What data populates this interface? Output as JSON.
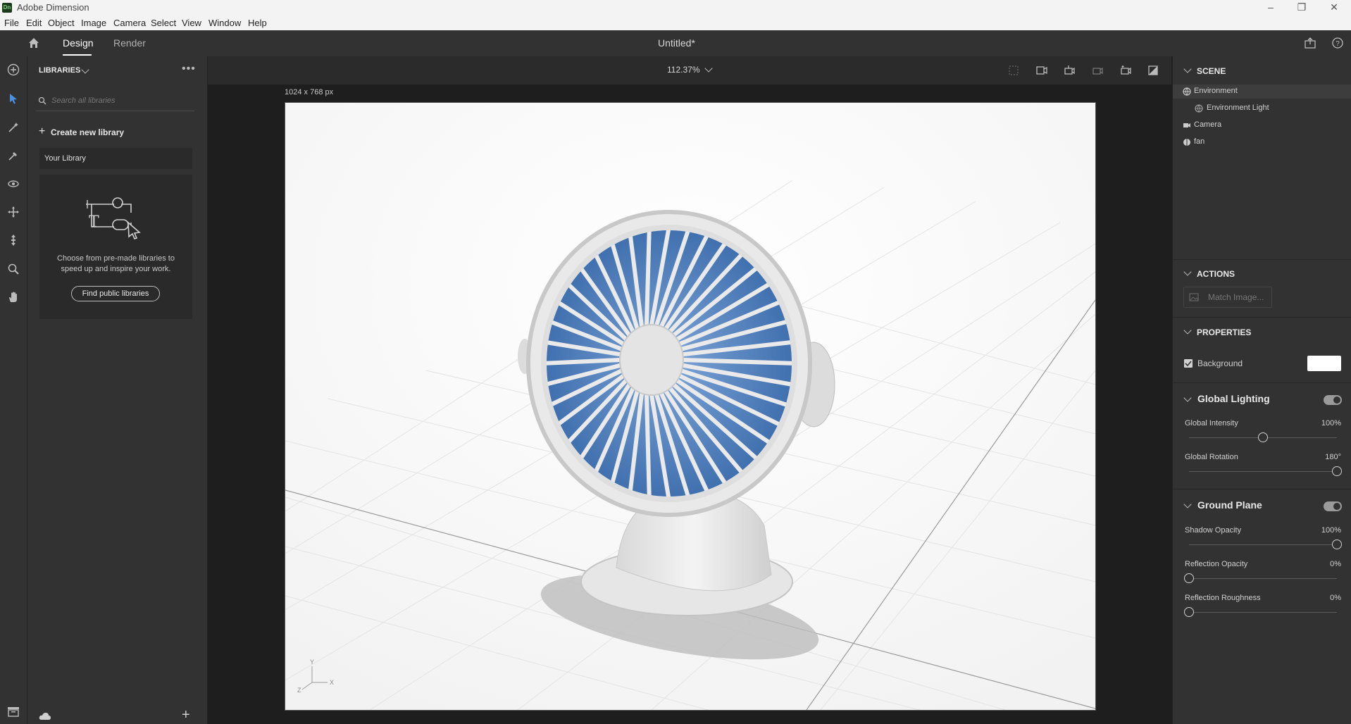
{
  "window": {
    "app_title": "Adobe Dimension",
    "logo_text": "Dn"
  },
  "menu": [
    "File",
    "Edit",
    "Object",
    "Image",
    "Camera",
    "Select",
    "View",
    "Window",
    "Help"
  ],
  "header": {
    "tabs": [
      "Design",
      "Render"
    ],
    "active_tab": "Design",
    "document_title": "Untitled*"
  },
  "libraries": {
    "title": "LIBRARIES",
    "search_placeholder": "Search all libraries",
    "create_label": "Create new library",
    "your_library": "Your Library",
    "promo_text": "Choose from pre-made libraries to speed up and inspire your work.",
    "find_button": "Find public libraries"
  },
  "canvas": {
    "zoom": "112.37%",
    "size_label": "1024 x 768 px",
    "axis_y": "Y",
    "axis_x": "X",
    "axis_z": "Z"
  },
  "scene": {
    "title": "SCENE",
    "items": [
      {
        "label": "Environment",
        "icon": "environment-icon"
      },
      {
        "label": "Environment Light",
        "icon": "globe-icon"
      },
      {
        "label": "Camera",
        "icon": "camera-icon"
      },
      {
        "label": "fan",
        "icon": "model-icon"
      }
    ]
  },
  "actions": {
    "title": "ACTIONS",
    "match_image": "Match Image..."
  },
  "properties": {
    "title": "PROPERTIES",
    "background_label": "Background",
    "background_color": "#ffffff",
    "global_lighting": "Global Lighting",
    "global_intensity_label": "Global Intensity",
    "global_intensity_value": "100%",
    "global_intensity_fraction": 0.5,
    "global_rotation_label": "Global Rotation",
    "global_rotation_value": "180°",
    "global_rotation_fraction": 1.0,
    "ground_plane": "Ground Plane",
    "shadow_opacity_label": "Shadow Opacity",
    "shadow_opacity_value": "100%",
    "shadow_opacity_fraction": 1.0,
    "reflection_opacity_label": "Reflection Opacity",
    "reflection_opacity_value": "0%",
    "reflection_opacity_fraction": 0.0,
    "reflection_roughness_label": "Reflection Roughness",
    "reflection_roughness_value": "0%",
    "reflection_roughness_fraction": 0.0
  },
  "colors": {
    "panel": "#323232",
    "canvas_bg": "#1e1e1e",
    "accent": "#4a90e2",
    "fan_blade": "#4f7fbf"
  }
}
